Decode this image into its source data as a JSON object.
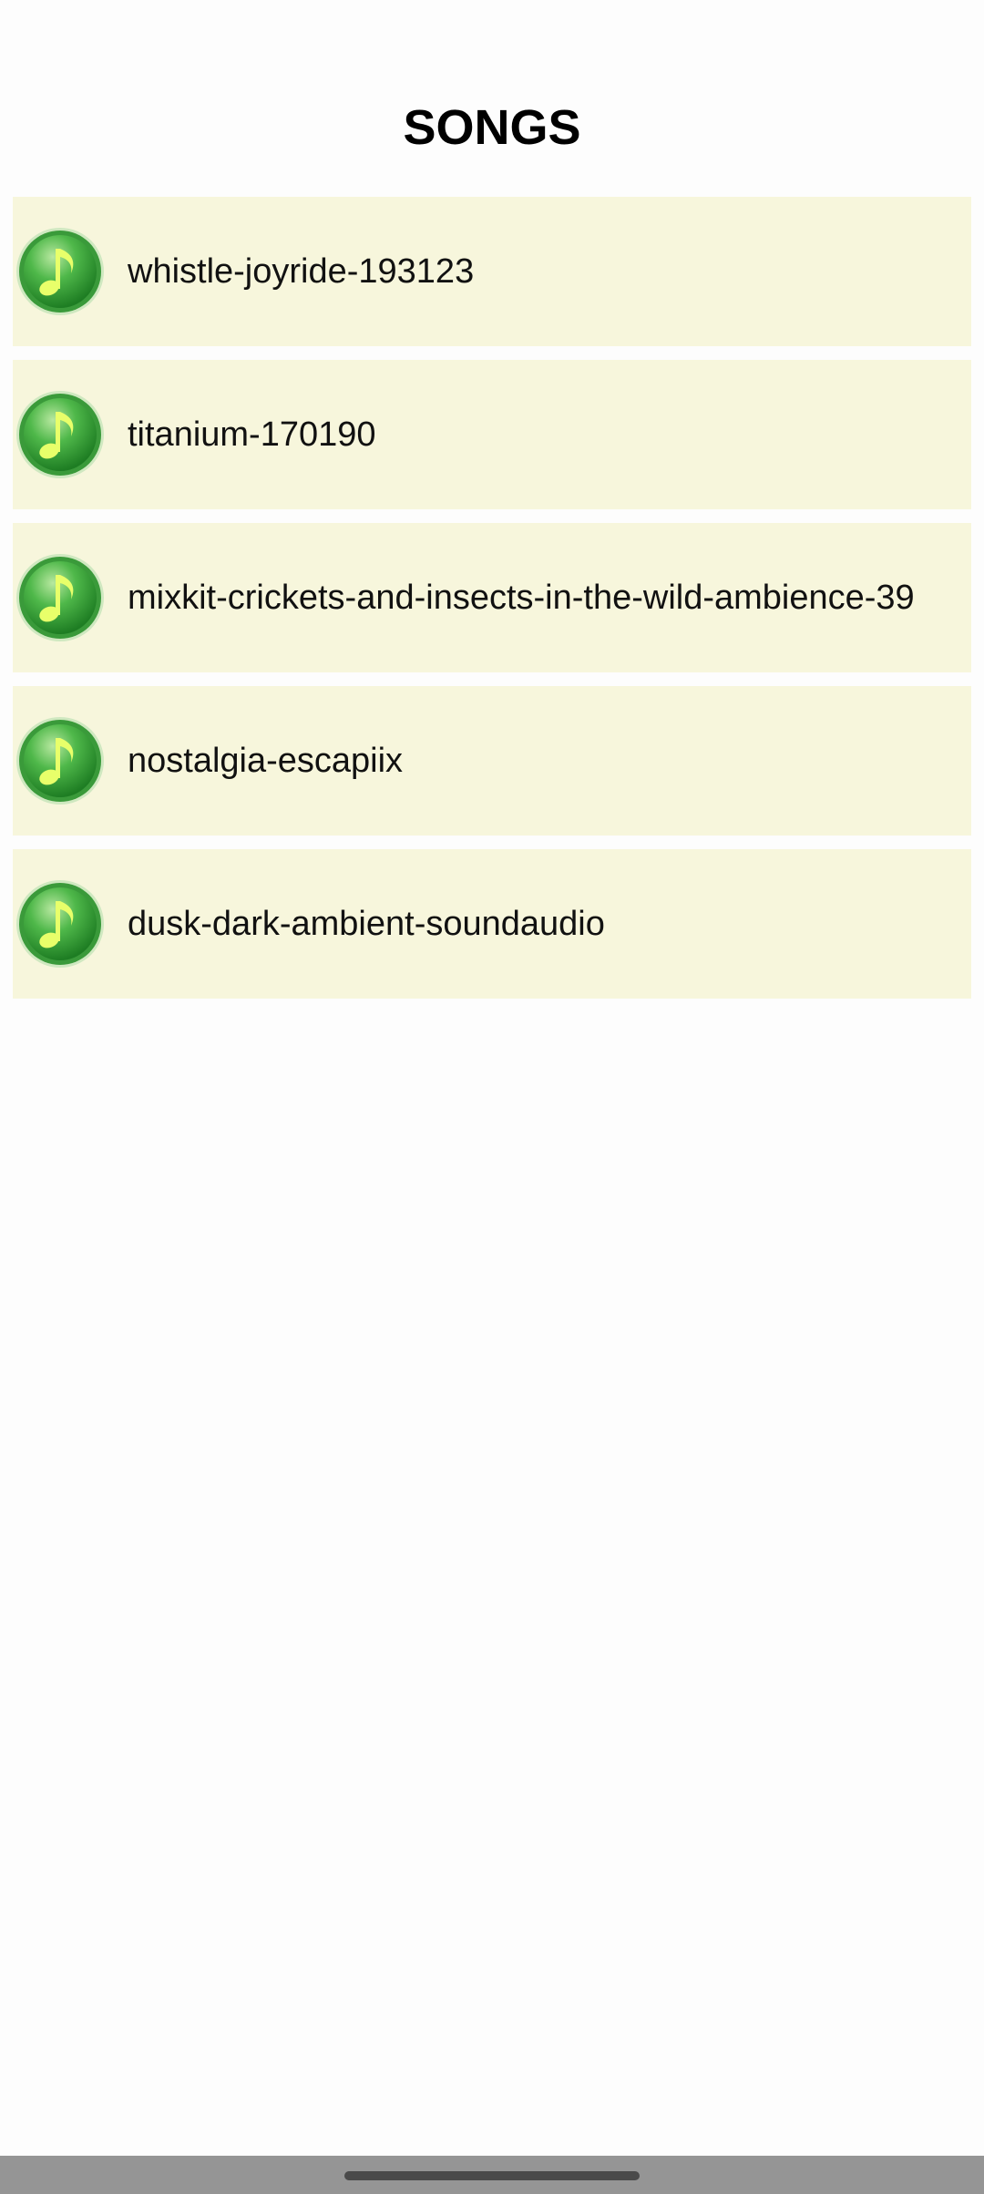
{
  "header": {
    "title": "SONGS"
  },
  "songs": [
    {
      "title": "whistle-joyride-193123",
      "icon": "music-note-icon"
    },
    {
      "title": "titanium-170190",
      "icon": "music-note-icon"
    },
    {
      "title": "mixkit-crickets-and-insects-in-the-wild-ambience-39",
      "icon": "music-note-icon"
    },
    {
      "title": "nostalgia-escapiix",
      "icon": "music-note-icon"
    },
    {
      "title": "dusk-dark-ambient-soundaudio",
      "icon": "music-note-icon"
    }
  ],
  "colors": {
    "row_background": "#f7f6dc",
    "icon_green": "#2e9a2e",
    "note_yellow": "#e8ff6a",
    "nav_bar": "#959595"
  }
}
